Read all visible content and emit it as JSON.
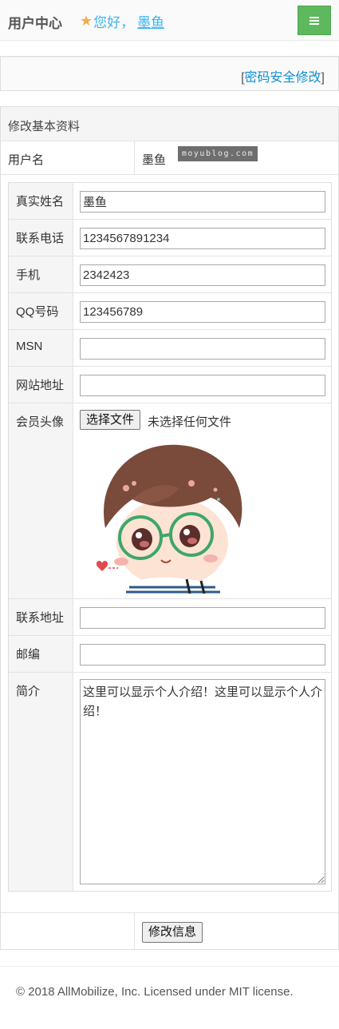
{
  "header": {
    "brand": "用户中心",
    "greeting": "您好，",
    "username": "墨鱼",
    "star_icon": "star-icon",
    "menu_icon": "hamburger-icon",
    "accent": "#3bb4f2",
    "menu_color": "#5eb95e"
  },
  "password_link": {
    "open": "[",
    "label": "密码安全修改",
    "close": "]"
  },
  "panel": {
    "title": "修改基本资料",
    "username_label": "用户名",
    "username_value": "墨鱼",
    "watermark": "moyublog.com"
  },
  "form": {
    "fields": [
      {
        "label": "真实姓名",
        "value": "墨鱼"
      },
      {
        "label": "联系电话",
        "value": "1234567891234"
      },
      {
        "label": "手机",
        "value": "2342423"
      },
      {
        "label": "QQ号码",
        "value": "123456789"
      },
      {
        "label": "MSN",
        "value": ""
      },
      {
        "label": "网站地址",
        "value": ""
      }
    ],
    "avatar": {
      "label": "会员头像",
      "button": "选择文件",
      "status": "未选择任何文件"
    },
    "address": {
      "label": "联系地址",
      "value": ""
    },
    "zip": {
      "label": "邮编",
      "value": ""
    },
    "intro": {
      "label": "简介",
      "value": "这里可以显示个人介绍！这里可以显示个人介绍！"
    }
  },
  "submit_label": "修改信息",
  "footer": "© 2018 AllMobilize, Inc. Licensed under MIT license."
}
